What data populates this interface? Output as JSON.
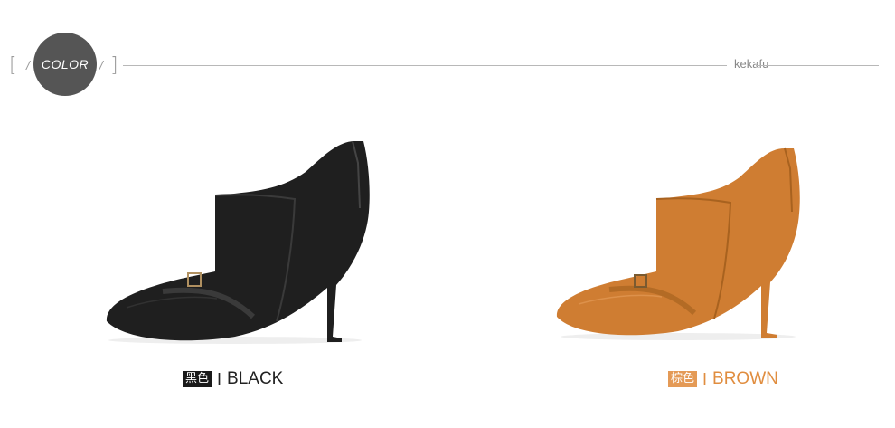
{
  "header": {
    "badge_label": "COLOR",
    "brand": "kekafu"
  },
  "products": [
    {
      "color_cn": "黑色",
      "color_en": "BLACK",
      "tag_color": "#1a1a1a",
      "text_color": "#222222",
      "shoe_color": "#1f1f1f"
    },
    {
      "color_cn": "棕色",
      "color_en": "BROWN",
      "tag_color": "#e49a56",
      "text_color": "#e08d3f",
      "shoe_color": "#cf7d32"
    }
  ],
  "colors": {
    "badge_bg": "#555555",
    "rule": "#b8b8b8"
  }
}
